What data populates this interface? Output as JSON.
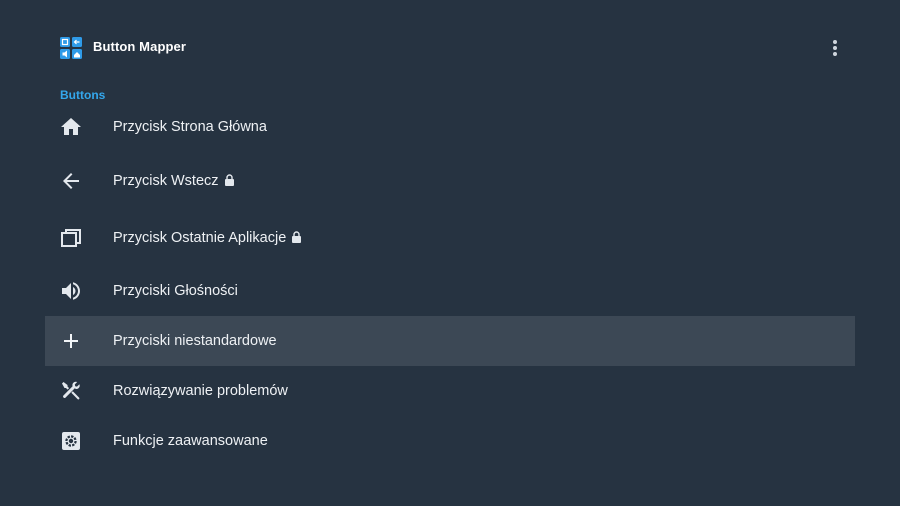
{
  "app": {
    "title": "Button Mapper",
    "icon": "button-mapper-app-icon",
    "menu_icon": "more-vert-icon"
  },
  "section": {
    "title": "Buttons"
  },
  "items": [
    {
      "label": "Przycisk Strona Główna",
      "icon": "home-icon",
      "locked": false
    },
    {
      "label": "Przycisk Wstecz",
      "icon": "arrow-back-icon",
      "locked": true
    },
    {
      "label": "Przycisk Ostatnie Aplikacje",
      "icon": "recent-apps-icon",
      "locked": true
    },
    {
      "label": "Przyciski Głośności",
      "icon": "volume-icon",
      "locked": false
    },
    {
      "label": "Przyciski niestandardowe",
      "icon": "plus-icon",
      "locked": false,
      "focused": true
    },
    {
      "label": "Rozwiązywanie problemów",
      "icon": "tools-icon",
      "locked": false
    },
    {
      "label": "Funkcje zaawansowane",
      "icon": "settings-box-icon",
      "locked": false
    }
  ],
  "colors": {
    "background": "#263341",
    "focused_row": "#3c4855",
    "accent": "#34a7ec",
    "text": "#eef1f4"
  }
}
